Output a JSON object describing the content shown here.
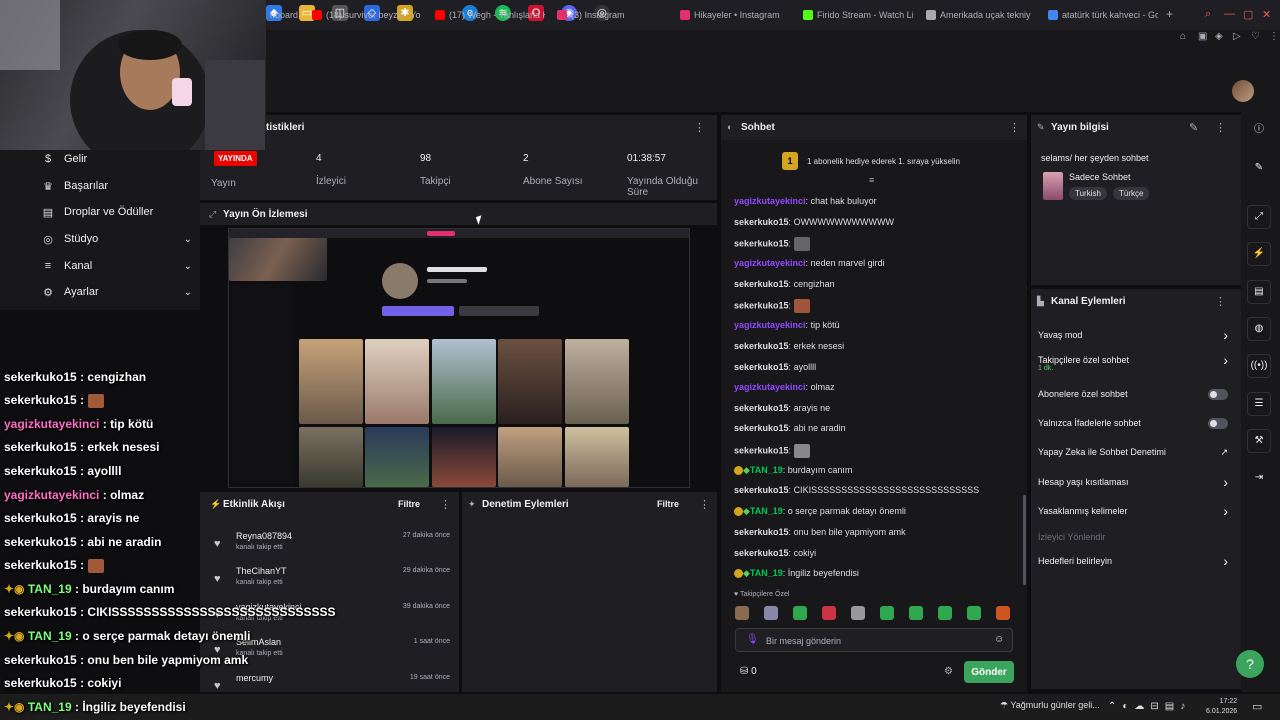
{
  "browser": {
    "tabs": [
      {
        "label": "hboard",
        "color": "#9147ff"
      },
      {
        "label": "(18) survivor beyza - Yo",
        "color": "#ff0000"
      },
      {
        "label": "(17) Wegh - Yanlışlarla K",
        "color": "#ff0000"
      },
      {
        "label": "(3) Instagram",
        "color": "#e1306c"
      },
      {
        "label": "Hikayeler • Instagram",
        "color": "#e1306c"
      },
      {
        "label": "Firido Stream - Watch Li",
        "color": "#53fc18"
      },
      {
        "label": "Amerikada uçak tekniy",
        "color": "#aaaaaa"
      },
      {
        "label": "atatürk türk kahveci - Go",
        "color": "#4285f4"
      }
    ],
    "new_tab": "+"
  },
  "leftnav": {
    "items": [
      {
        "label": "Gelir",
        "icon": "dollar-icon"
      },
      {
        "label": "Başarılar",
        "icon": "trophy-icon"
      },
      {
        "label": "Droplar ve Ödüller",
        "icon": "gift-icon"
      },
      {
        "label": "Stüdyo",
        "icon": "studio-icon"
      },
      {
        "label": "Kanal",
        "icon": "channel-icon"
      },
      {
        "label": "Ayarlar",
        "icon": "gear-icon"
      }
    ]
  },
  "stats": {
    "title": "tistikleri",
    "live_badge": "YAYINDA",
    "stream_label": "Yayın",
    "items": [
      {
        "value": "4",
        "label": "İzleyici"
      },
      {
        "value": "98",
        "label": "Takipçi"
      },
      {
        "value": "2",
        "label": "Abone Sayısı"
      },
      {
        "value": "01:38:57",
        "label": "Yayında Olduğu Süre"
      }
    ]
  },
  "preview": {
    "title": "Yayın Ön İzlemesi"
  },
  "activity": {
    "title": "Etkinlik Akışı",
    "filter": "Filtre",
    "rows": [
      {
        "name": "Reyna087894",
        "sub": "kanalı takip etti",
        "time": "27 dakika önce"
      },
      {
        "name": "TheCihanYT",
        "sub": "kanalı takip etti",
        "time": "29 dakika önce"
      },
      {
        "name": "yagizkutayekinci",
        "sub": "kanalı takip etti",
        "time": "39 dakika önce"
      },
      {
        "name": "SelimAslan",
        "sub": "kanalı takip etti",
        "time": "1 saat önce"
      },
      {
        "name": "mercumy",
        "sub": "",
        "time": "19 saat önce"
      }
    ]
  },
  "modactions": {
    "title": "Denetim Eylemleri",
    "filter": "Filtre"
  },
  "chat": {
    "title": "Sohbet",
    "banner": "1 abonelik hediye ederek 1. sıraya yükselin",
    "banner_rank": "1",
    "lines": [
      {
        "user": "yagizkutayekinci",
        "color": "purple",
        "text": "chat hak buluyor"
      },
      {
        "user": "sekerkuko15",
        "color": "grey",
        "text": "OWWWWWWWWWWW"
      },
      {
        "user": "sekerkuko15",
        "color": "grey",
        "text": "",
        "emote": "#666666"
      },
      {
        "user": "yagizkutayekinci",
        "color": "purple",
        "text": "neden marvel girdi"
      },
      {
        "user": "sekerkuko15",
        "color": "grey",
        "text": "cengizhan"
      },
      {
        "user": "sekerkuko15",
        "color": "grey",
        "text": "",
        "emote": "#a0553a"
      },
      {
        "user": "yagizkutayekinci",
        "color": "purple",
        "text": "tip kötü"
      },
      {
        "user": "sekerkuko15",
        "color": "grey",
        "text": "erkek nesesi"
      },
      {
        "user": "sekerkuko15",
        "color": "grey",
        "text": "ayollll"
      },
      {
        "user": "yagizkutayekinci",
        "color": "purple",
        "text": "olmaz"
      },
      {
        "user": "sekerkuko15",
        "color": "grey",
        "text": "arayis ne"
      },
      {
        "user": "sekerkuko15",
        "color": "grey",
        "text": "abi ne aradin"
      },
      {
        "user": "sekerkuko15",
        "color": "grey",
        "text": "",
        "emote": "#888888"
      },
      {
        "user": "TAN_19",
        "color": "green",
        "text": "burdayım canım",
        "badges": true
      },
      {
        "user": "sekerkuko15",
        "color": "grey",
        "text": "CIKISSSSSSSSSSSSSSSSSSSSSSSSSSSS"
      },
      {
        "user": "TAN_19",
        "color": "green",
        "text": "o serçe parmak detayı önemli",
        "badges": true
      },
      {
        "user": "sekerkuko15",
        "color": "grey",
        "text": "onu ben bile yapmiyom amk"
      },
      {
        "user": "sekerkuko15",
        "color": "grey",
        "text": "cokiyi"
      },
      {
        "user": "TAN_19",
        "color": "green",
        "text": "İngiliz beyefendisi",
        "badges": true
      }
    ],
    "emote_label": "Takipçilere Özel",
    "emote_colors": [
      "#8a6a50",
      "#8888aa",
      "#2fa84f",
      "#cc3344",
      "#999999",
      "#2fa84f",
      "#2fa84f",
      "#2fa84f",
      "#2fa84f",
      "#cc5522"
    ],
    "input_placeholder": "Bir mesaj gönderin",
    "points": "0",
    "send_label": "Gönder"
  },
  "info": {
    "title": "Yayın bilgisi",
    "stream_title": "selams/ her şeyden sohbet",
    "category": "Sadece Sohbet",
    "tags": [
      "Turkish",
      "Türkçe"
    ]
  },
  "events": {
    "title": "Kanal Eylemleri",
    "items": [
      {
        "label": "Yavaş mod",
        "sub": "",
        "control": "chevron",
        "enabled": true
      },
      {
        "label": "Takipçilere özel sohbet",
        "sub": "1 dk.",
        "control": "chevron",
        "enabled": true
      },
      {
        "label": "Abonelere özel sohbet",
        "sub": "",
        "control": "toggle",
        "enabled": true
      },
      {
        "label": "Yalnızca İfadelerle sohbet",
        "sub": "",
        "control": "toggle",
        "enabled": true
      },
      {
        "label": "Yapay Zeka ile Sohbet Denetimi",
        "sub": "",
        "control": "external",
        "enabled": true
      },
      {
        "label": "Hesap yaşı kısıtlaması",
        "sub": "",
        "control": "chevron",
        "enabled": true
      },
      {
        "label": "Yasaklanmış kelimeler",
        "sub": "",
        "control": "chevron",
        "enabled": true
      },
      {
        "label": "İzleyici Yönlendir",
        "sub": "",
        "control": "none",
        "enabled": false
      },
      {
        "label": "Hedefleri belirleyin",
        "sub": "",
        "control": "chevron",
        "enabled": true
      }
    ]
  },
  "overlay": {
    "lines": [
      {
        "user": "sekerkuko15",
        "text": ": cengizhan",
        "color": "white"
      },
      {
        "user": "sekerkuko15",
        "text": ":",
        "color": "white",
        "emote": true
      },
      {
        "user": "yagizkutayekinci",
        "text": ": tip kötü",
        "color": "pink"
      },
      {
        "user": "sekerkuko15",
        "text": ": erkek nesesi",
        "color": "white"
      },
      {
        "user": "sekerkuko15",
        "text": ": ayollll",
        "color": "white"
      },
      {
        "user": "yagizkutayekinci",
        "text": ": olmaz",
        "color": "pink"
      },
      {
        "user": "sekerkuko15",
        "text": ": arayis ne",
        "color": "white"
      },
      {
        "user": "sekerkuko15",
        "text": ": abi ne aradin",
        "color": "white"
      },
      {
        "user": "sekerkuko15",
        "text": ":",
        "color": "white",
        "emote": true
      },
      {
        "user": "TAN_19",
        "text": ": burdayım canım",
        "color": "green"
      },
      {
        "user": "sekerkuko15",
        "text": ": CIKISSSSSSSSSSSSSSSSSSSSSSSSSSSS",
        "color": "white"
      },
      {
        "user": "TAN_19",
        "text": ": o serçe parmak detayı önemli",
        "color": "green"
      },
      {
        "user": "sekerkuko15",
        "text": ": onu ben bile yapmiyom amk",
        "color": "white"
      },
      {
        "user": "sekerkuko15",
        "text": ": cokiyi",
        "color": "white"
      },
      {
        "user": "TAN_19",
        "text": ": İngiliz beyefendisi",
        "color": "green"
      }
    ]
  },
  "taskbar": {
    "weather": "Yağmurlu günler geli...",
    "time": "17:22",
    "date": "6.01.2026"
  }
}
